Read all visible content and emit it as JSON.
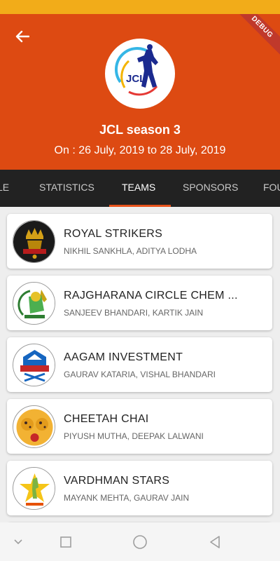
{
  "header": {
    "debug_label": "DEBUG",
    "title": "JCL season 3",
    "dates": "On : 26 July, 2019 to 28 July, 2019",
    "logo_text": "JCL",
    "bg_color": "#dd4a12"
  },
  "tabs": [
    {
      "label": "SCHEDULE",
      "visible_text": "LE",
      "active": false
    },
    {
      "label": "STATISTICS",
      "active": false
    },
    {
      "label": "TEAMS",
      "active": true
    },
    {
      "label": "SPONSORS",
      "active": false
    },
    {
      "label": "FOUNDERS",
      "visible_text": "FOU",
      "active": false
    }
  ],
  "teams": [
    {
      "name": "ROYAL STRIKERS",
      "owners": "NIKHIL SANKHLA, ADITYA LODHA",
      "logo_icon": "royal-strikers-crest-icon"
    },
    {
      "name": "RAJGHARANA CIRCLE CHEM ...",
      "owners": "SANJEEV BHANDARI, KARTIK JAIN",
      "logo_icon": "rajgharana-lion-icon"
    },
    {
      "name": "AAGAM INVESTMENT",
      "owners": "GAURAV KATARIA, VISHAL BHANDARI",
      "logo_icon": "aagam-shield-icon"
    },
    {
      "name": "CHEETAH CHAI",
      "owners": "PIYUSH MUTHA, DEEPAK LALWANI",
      "logo_icon": "cheetah-chai-icon"
    },
    {
      "name": "VARDHMAN STARS",
      "owners": "MAYANK MEHTA, GAURAV JAIN",
      "logo_icon": "vardhman-star-icon"
    }
  ],
  "colors": {
    "status_bar": "#f2ac19",
    "tab_bar": "#222222",
    "tab_indicator": "#e8531b"
  }
}
